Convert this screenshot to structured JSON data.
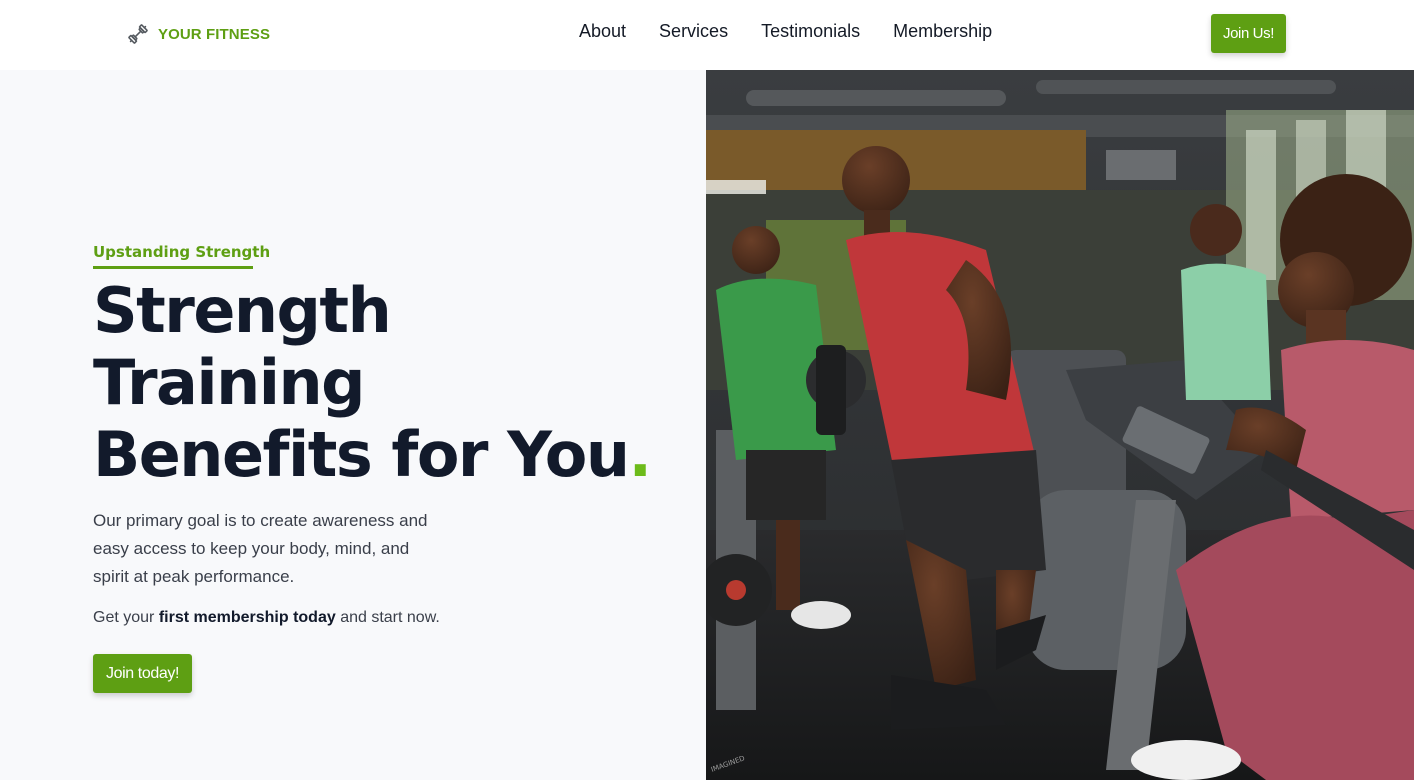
{
  "brand": {
    "name": "YOUR FITNESS",
    "icon": "dumbbell-icon",
    "color": "#5e9f13"
  },
  "nav": {
    "items": [
      {
        "label": "About"
      },
      {
        "label": "Services"
      },
      {
        "label": "Testimonials"
      },
      {
        "label": "Membership"
      }
    ],
    "join_label": "Join Us!"
  },
  "hero": {
    "eyebrow": "Upstanding Strength",
    "title_lines": [
      "Strength",
      "Training",
      "Benefits for You"
    ],
    "title_accent": ".",
    "description": "Our primary goal is to create awareness and easy access to keep your body, mind, and spirit at peak performance.",
    "cta": {
      "prefix": "Get your ",
      "bold": "first membership today",
      "suffix": " and start now."
    },
    "button_label": "Join today!",
    "image_watermark": "IMAGINED"
  },
  "colors": {
    "accent": "#5e9f13",
    "accent_dot": "#6dbb1a",
    "heading": "#121a2b",
    "background": "#f8f9fb"
  }
}
